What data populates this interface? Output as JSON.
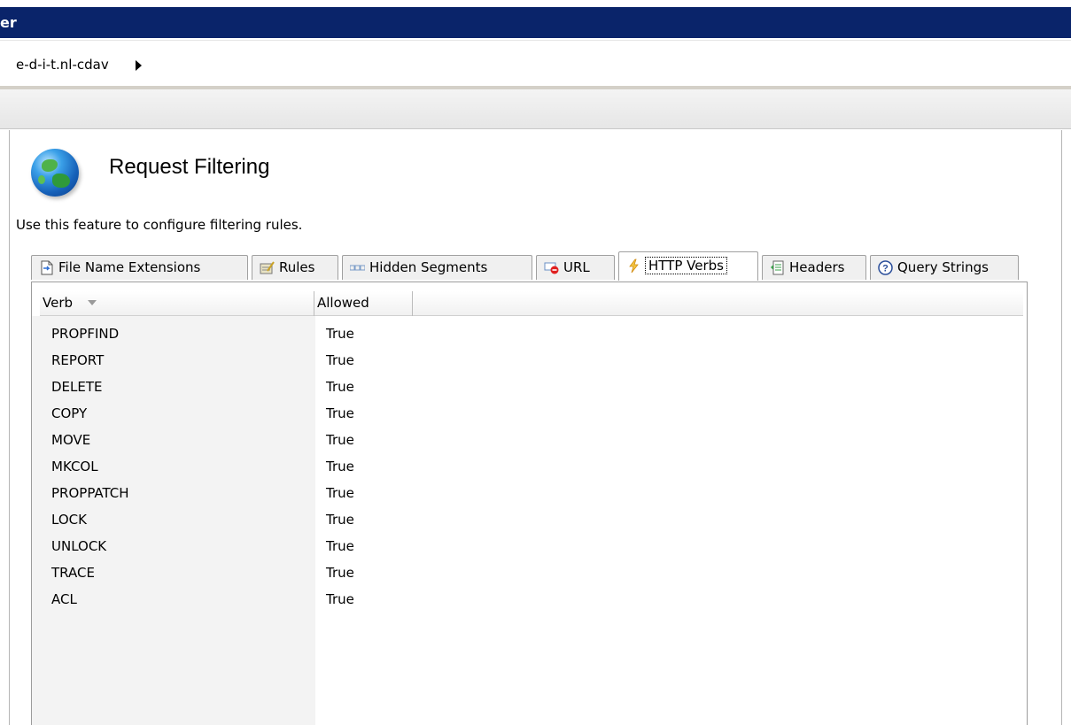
{
  "window": {
    "title": "er"
  },
  "address": {
    "crumb": "e-d-i-t.nl-cdav"
  },
  "feature": {
    "title": "Request Filtering",
    "description": "Use this feature to configure filtering rules."
  },
  "tabs": [
    {
      "label": "File Name Extensions",
      "icon": "file-extension-icon"
    },
    {
      "label": "Rules",
      "icon": "rules-icon"
    },
    {
      "label": "Hidden Segments",
      "icon": "hidden-segments-icon"
    },
    {
      "label": "URL",
      "icon": "url-block-icon"
    },
    {
      "label": "HTTP Verbs",
      "icon": "lightning-icon",
      "active": true
    },
    {
      "label": "Headers",
      "icon": "headers-icon"
    },
    {
      "label": "Query Strings",
      "icon": "help-question-icon"
    }
  ],
  "grid": {
    "columns": [
      "Verb",
      "Allowed"
    ],
    "sorted_column": "Verb",
    "rows": [
      {
        "verb": "PROPFIND",
        "allowed": "True"
      },
      {
        "verb": "REPORT",
        "allowed": "True"
      },
      {
        "verb": "DELETE",
        "allowed": "True"
      },
      {
        "verb": "COPY",
        "allowed": "True"
      },
      {
        "verb": "MOVE",
        "allowed": "True"
      },
      {
        "verb": "MKCOL",
        "allowed": "True"
      },
      {
        "verb": "PROPPATCH",
        "allowed": "True"
      },
      {
        "verb": "LOCK",
        "allowed": "True"
      },
      {
        "verb": "UNLOCK",
        "allowed": "True"
      },
      {
        "verb": "TRACE",
        "allowed": "True"
      },
      {
        "verb": "ACL",
        "allowed": "True"
      }
    ]
  },
  "colors": {
    "titlebar": "#0a246a",
    "panel": "#f3f3f3"
  }
}
